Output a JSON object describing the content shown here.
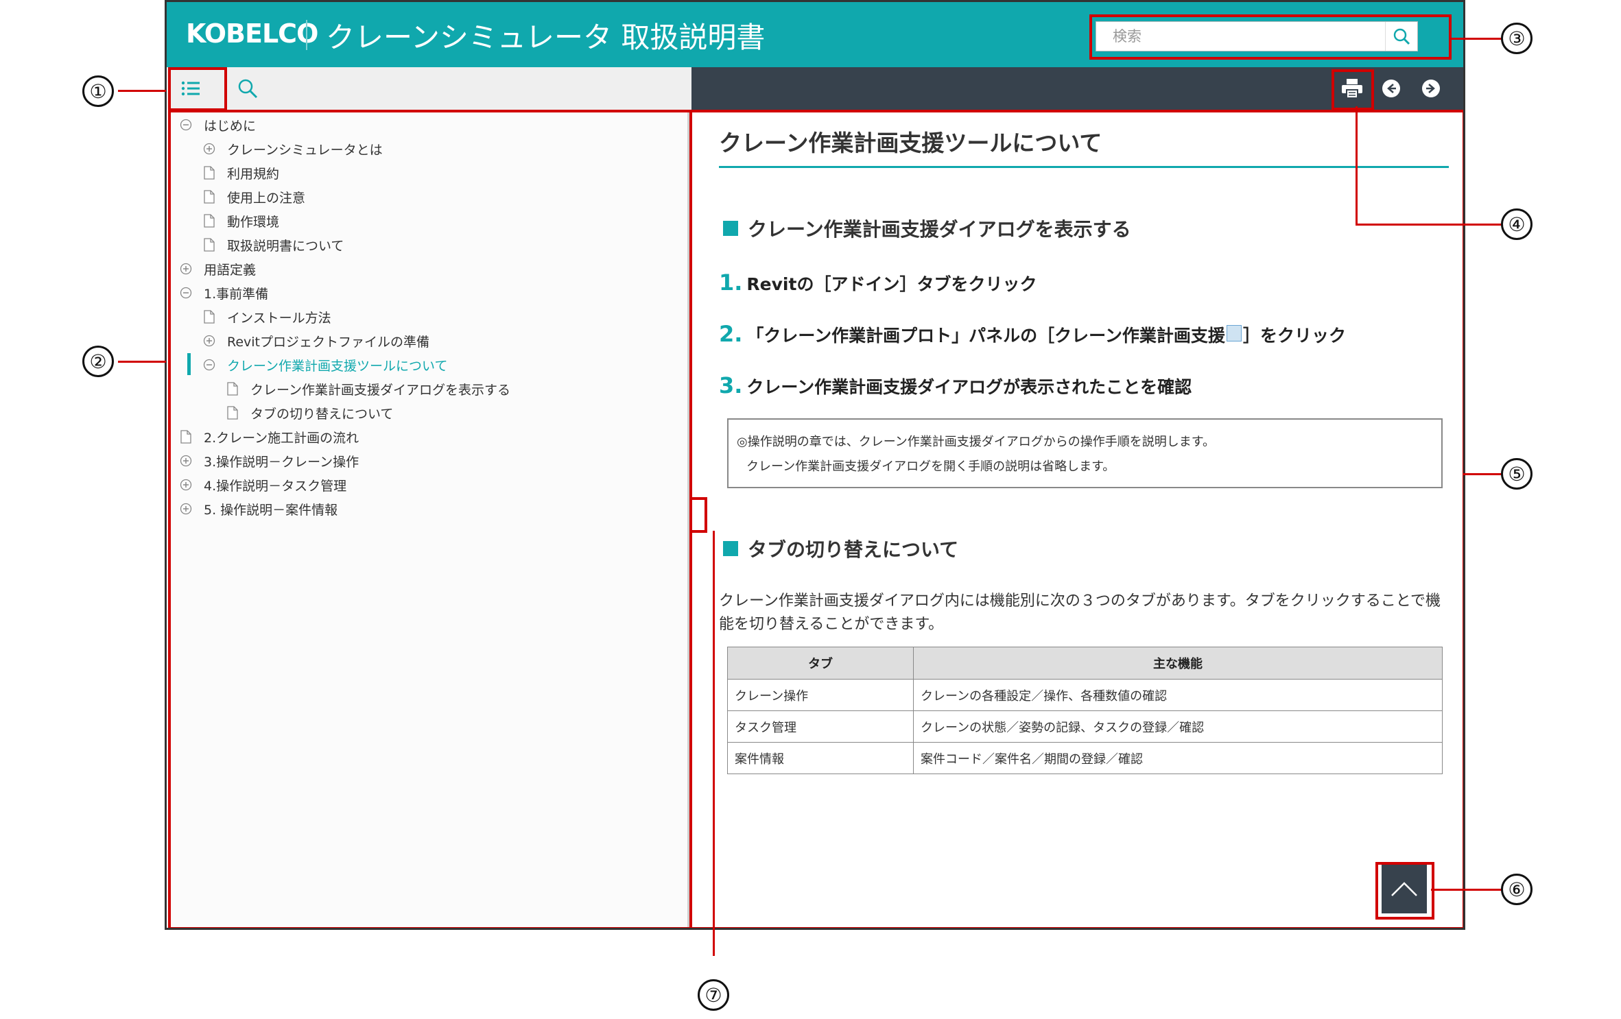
{
  "header": {
    "logo": "KOBELCO",
    "title": "クレーンシミュレータ 取扱説明書",
    "search_placeholder": "検索"
  },
  "sidebar": {
    "items": [
      {
        "label": "はじめに",
        "icon": "collapse-circle-icon"
      },
      {
        "label": "クレーンシミュレータとは",
        "icon": "expand-circle-icon"
      },
      {
        "label": "利用規約",
        "icon": "document-icon"
      },
      {
        "label": "使用上の注意",
        "icon": "document-icon"
      },
      {
        "label": "動作環境",
        "icon": "document-icon"
      },
      {
        "label": "取扱説明書について",
        "icon": "document-icon"
      },
      {
        "label": "用語定義",
        "icon": "expand-circle-icon"
      },
      {
        "label": "1.事前準備",
        "icon": "collapse-circle-icon"
      },
      {
        "label": "インストール方法",
        "icon": "document-icon"
      },
      {
        "label": "Revitプロジェクトファイルの準備",
        "icon": "expand-circle-icon"
      },
      {
        "label": "クレーン作業計画支援ツールについて",
        "icon": "collapse-circle-icon"
      },
      {
        "label": "クレーン作業計画支援ダイアログを表示する",
        "icon": "document-icon"
      },
      {
        "label": "タブの切り替えについて",
        "icon": "document-icon"
      },
      {
        "label": "2.クレーン施工計画の流れ",
        "icon": "document-icon"
      },
      {
        "label": "3.操作説明－クレーン操作",
        "icon": "expand-circle-icon"
      },
      {
        "label": "4.操作説明－タスク管理",
        "icon": "expand-circle-icon"
      },
      {
        "label": "5. 操作説明－案件情報",
        "icon": "expand-circle-icon"
      }
    ]
  },
  "content": {
    "title": "クレーン作業計画支援ツールについて",
    "section1": "クレーン作業計画支援ダイアログを表示する",
    "steps": [
      {
        "num": "1.",
        "text": "Revitの［アドイン］タブをクリック"
      },
      {
        "num": "2.",
        "text_before": "「クレーン作業計画プロト」パネルの［クレーン作業計画支援",
        "text_after": "］をクリック"
      },
      {
        "num": "3.",
        "text": "クレーン作業計画支援ダイアログが表示されたことを確認"
      }
    ],
    "note": {
      "line1": "◎操作説明の章では、クレーン作業計画支援ダイアログからの操作手順を説明します。",
      "line2": "クレーン作業計画支援ダイアログを開く手順の説明は省略します。"
    },
    "section2": "タブの切り替えについて",
    "paragraph": "クレーン作業計画支援ダイアログ内には機能別に次の３つのタブがあります。タブをクリックすることで機能を切り替えることができます。",
    "table": {
      "headers": [
        "タブ",
        "主な機能"
      ],
      "rows": [
        [
          "クレーン操作",
          "クレーンの各種設定／操作、各種数値の確認"
        ],
        [
          "タスク管理",
          "クレーンの状態／姿勢の記録、タスクの登録／確認"
        ],
        [
          "案件情報",
          "案件コード／案件名／期間の登録／確認"
        ]
      ]
    }
  },
  "callouts": [
    "①",
    "②",
    "③",
    "④",
    "⑤",
    "⑥",
    "⑦"
  ],
  "colors": {
    "accent": "#10a8ad",
    "dark": "#37424d",
    "highlight": "#d10000"
  }
}
